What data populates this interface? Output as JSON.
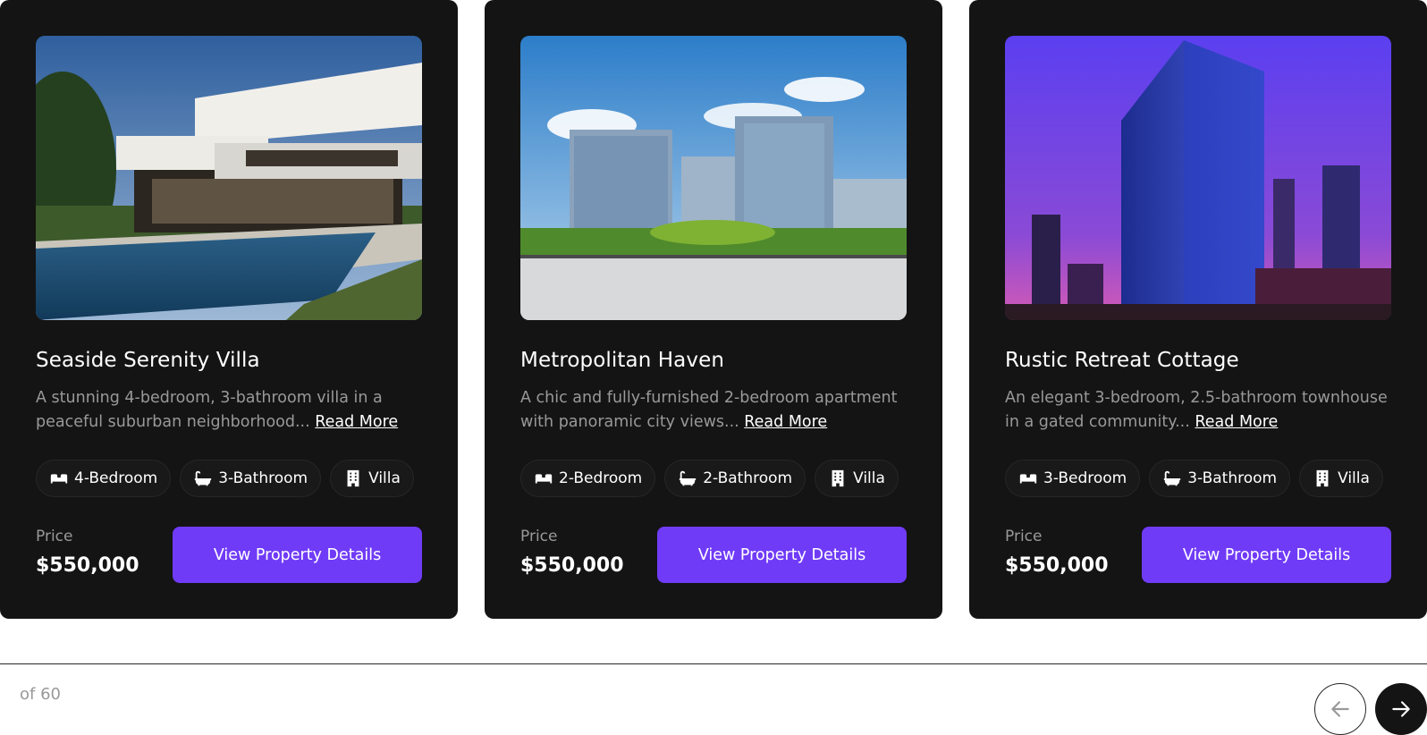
{
  "cards": [
    {
      "title": "Seaside Serenity Villa",
      "description": "A stunning 4-bedroom, 3-bathroom villa in a peaceful suburban neighborhood...",
      "read_more": "Read More",
      "tags": [
        {
          "icon": "bed-icon",
          "label": "4-Bedroom"
        },
        {
          "icon": "bathtub-icon",
          "label": "3-Bathroom"
        },
        {
          "icon": "building-icon",
          "label": "Villa"
        }
      ],
      "price_label": "Price",
      "price": "$550,000",
      "button_label": "View Property Details",
      "image": "modern-villa-with-pool"
    },
    {
      "title": "Metropolitan Haven",
      "description": "A chic and fully-furnished 2-bedroom apartment with panoramic city views...",
      "read_more": "Read More",
      "tags": [
        {
          "icon": "bed-icon",
          "label": "2-Bedroom"
        },
        {
          "icon": "bathtub-icon",
          "label": "2-Bathroom"
        },
        {
          "icon": "building-icon",
          "label": "Villa"
        }
      ],
      "price_label": "Price",
      "price": "$550,000",
      "button_label": "View Property Details",
      "image": "city-office-buildings"
    },
    {
      "title": "Rustic Retreat Cottage",
      "description": "An elegant 3-bedroom, 2.5-bathroom townhouse in a gated community...",
      "read_more": "Read More",
      "tags": [
        {
          "icon": "bed-icon",
          "label": "3-Bedroom"
        },
        {
          "icon": "bathtub-icon",
          "label": "3-Bathroom"
        },
        {
          "icon": "building-icon",
          "label": "Villa"
        }
      ],
      "price_label": "Price",
      "price": "$550,000",
      "button_label": "View Property Details",
      "image": "skyscraper-at-dusk"
    }
  ],
  "pagination": {
    "text": "of 60",
    "prev_icon": "arrow-left-icon",
    "next_icon": "arrow-right-icon"
  },
  "colors": {
    "card_bg": "#141414",
    "accent": "#703bf7",
    "muted_text": "#999999",
    "border": "#262626"
  }
}
